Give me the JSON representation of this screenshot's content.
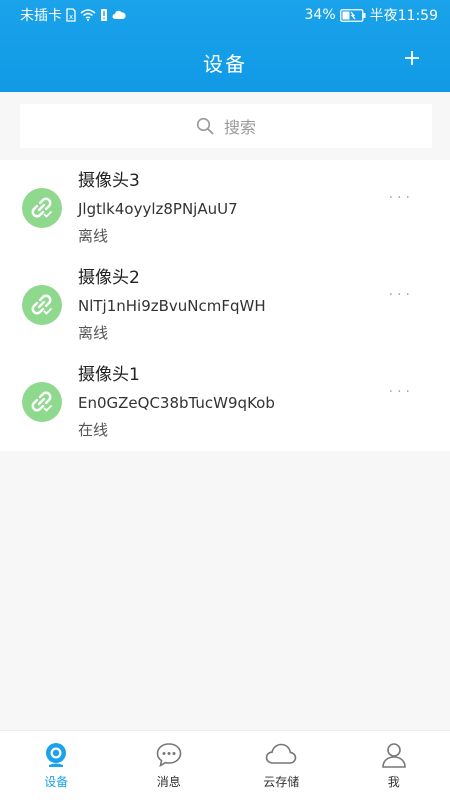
{
  "status_bar": {
    "carrier": "未插卡",
    "battery": "34%",
    "time": "半夜11:59"
  },
  "header": {
    "title": "设备",
    "add_icon": "plus-icon"
  },
  "search": {
    "placeholder": "搜索",
    "icon": "search-icon"
  },
  "devices": [
    {
      "name": "摄像头3",
      "uid": "Jlgtlk4oyylz8PNjAuU7",
      "status": "离线",
      "more": "···"
    },
    {
      "name": "摄像头2",
      "uid": "NlTj1nHi9zBvuNcmFqWH",
      "status": "离线",
      "more": "···"
    },
    {
      "name": "摄像头1",
      "uid": "En0GZeQC38bTucW9qKob",
      "status": "在线",
      "more": "···"
    }
  ],
  "bottom_nav": [
    {
      "label": "设备",
      "icon": "camera-icon",
      "active": true
    },
    {
      "label": "消息",
      "icon": "chat-bubble-icon",
      "active": false
    },
    {
      "label": "云存储",
      "icon": "cloud-icon",
      "active": false
    },
    {
      "label": "我",
      "icon": "user-icon",
      "active": false
    }
  ],
  "colors": {
    "brand": "#1aa3ea",
    "avatar": "#8fd98f"
  }
}
